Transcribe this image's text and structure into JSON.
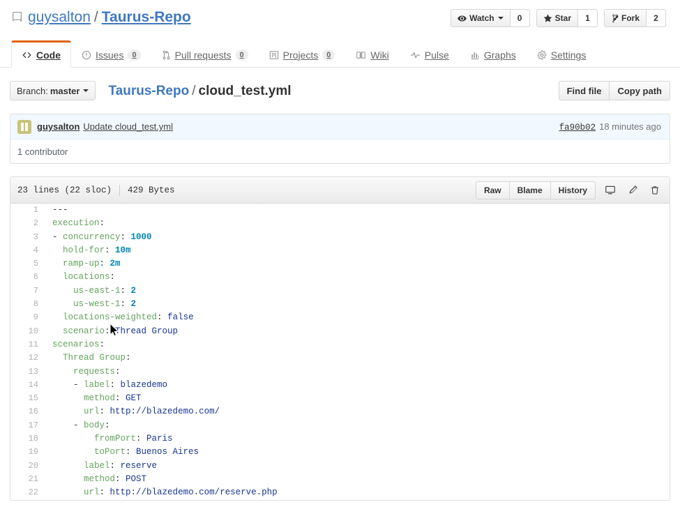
{
  "repo": {
    "icon": "repo-book-icon",
    "owner": "guysalton",
    "separator": "/",
    "name": "Taurus-Repo"
  },
  "actions": [
    {
      "icon": "eye-icon",
      "label": "Watch",
      "count": "0",
      "has_caret": true
    },
    {
      "icon": "star-icon",
      "label": "Star",
      "count": "1",
      "has_caret": false
    },
    {
      "icon": "fork-icon",
      "label": "Fork",
      "count": "2",
      "has_caret": false
    }
  ],
  "nav": {
    "tabs": [
      {
        "icon": "code-icon",
        "label": "Code",
        "counter": null,
        "selected": true
      },
      {
        "icon": "issue-opened-icon",
        "label": "Issues",
        "counter": "0",
        "selected": false
      },
      {
        "icon": "git-pull-request-icon",
        "label": "Pull requests",
        "counter": "0",
        "selected": false
      },
      {
        "icon": "project-icon",
        "label": "Projects",
        "counter": "0",
        "selected": false
      },
      {
        "icon": "book-icon",
        "label": "Wiki",
        "counter": null,
        "selected": false
      },
      {
        "icon": "pulse-icon",
        "label": "Pulse",
        "counter": null,
        "selected": false
      },
      {
        "icon": "graph-icon",
        "label": "Graphs",
        "counter": null,
        "selected": false
      },
      {
        "icon": "gear-icon",
        "label": "Settings",
        "counter": null,
        "selected": false
      }
    ]
  },
  "file_navigation": {
    "branch_prefix": "Branch:",
    "branch_name": "master",
    "breadcrumb_repo": "Taurus-Repo",
    "breadcrumb_separator": "/",
    "breadcrumb_file": "cloud_test.yml",
    "find_file_label": "Find file",
    "copy_path_label": "Copy path"
  },
  "commit": {
    "avatar": "user-avatar",
    "author": "guysalton",
    "message": "Update cloud_test.yml",
    "sha": "fa90b02",
    "time": "18 minutes ago",
    "contributors": "1 contributor"
  },
  "file": {
    "lines_info": "23 lines (22 sloc)",
    "size": "429 Bytes",
    "buttons": [
      "Raw",
      "Blame",
      "History"
    ],
    "icons": [
      "desktop-download-icon",
      "pencil-edit-icon",
      "trash-delete-icon"
    ],
    "lines": [
      {
        "num": "1",
        "tokens": [
          {
            "t": "---",
            "c": "p"
          }
        ]
      },
      {
        "num": "2",
        "tokens": [
          {
            "t": "execution",
            "c": "k"
          },
          {
            "t": ":",
            "c": "p"
          }
        ]
      },
      {
        "num": "3",
        "tokens": [
          {
            "t": "- ",
            "c": "p"
          },
          {
            "t": "concurrency",
            "c": "k"
          },
          {
            "t": ": ",
            "c": "p"
          },
          {
            "t": "1000",
            "c": "n"
          }
        ]
      },
      {
        "num": "4",
        "tokens": [
          {
            "t": "  ",
            "c": "p"
          },
          {
            "t": "hold-for",
            "c": "k"
          },
          {
            "t": ": ",
            "c": "p"
          },
          {
            "t": "10m",
            "c": "n"
          }
        ]
      },
      {
        "num": "5",
        "tokens": [
          {
            "t": "  ",
            "c": "p"
          },
          {
            "t": "ramp-up",
            "c": "k"
          },
          {
            "t": ": ",
            "c": "p"
          },
          {
            "t": "2m",
            "c": "n"
          }
        ]
      },
      {
        "num": "6",
        "tokens": [
          {
            "t": "  ",
            "c": "p"
          },
          {
            "t": "locations",
            "c": "k"
          },
          {
            "t": ":",
            "c": "p"
          }
        ]
      },
      {
        "num": "7",
        "tokens": [
          {
            "t": "    ",
            "c": "p"
          },
          {
            "t": "us-east-1",
            "c": "k"
          },
          {
            "t": ": ",
            "c": "p"
          },
          {
            "t": "2",
            "c": "n"
          }
        ]
      },
      {
        "num": "8",
        "tokens": [
          {
            "t": "    ",
            "c": "p"
          },
          {
            "t": "us-west-1",
            "c": "k"
          },
          {
            "t": ": ",
            "c": "p"
          },
          {
            "t": "2",
            "c": "n"
          }
        ]
      },
      {
        "num": "9",
        "tokens": [
          {
            "t": "  ",
            "c": "p"
          },
          {
            "t": "locations-weighted",
            "c": "k"
          },
          {
            "t": ": ",
            "c": "p"
          },
          {
            "t": "false",
            "c": "s"
          }
        ]
      },
      {
        "num": "10",
        "tokens": [
          {
            "t": "  ",
            "c": "p"
          },
          {
            "t": "scenario",
            "c": "k"
          },
          {
            "t": ": ",
            "c": "p"
          },
          {
            "t": "Thread Group",
            "c": "s"
          }
        ]
      },
      {
        "num": "11",
        "tokens": [
          {
            "t": "scenarios",
            "c": "k"
          },
          {
            "t": ":",
            "c": "p"
          }
        ]
      },
      {
        "num": "12",
        "tokens": [
          {
            "t": "  ",
            "c": "p"
          },
          {
            "t": "Thread Group",
            "c": "k"
          },
          {
            "t": ":",
            "c": "p"
          }
        ]
      },
      {
        "num": "13",
        "tokens": [
          {
            "t": "    ",
            "c": "p"
          },
          {
            "t": "requests",
            "c": "k"
          },
          {
            "t": ":",
            "c": "p"
          }
        ]
      },
      {
        "num": "14",
        "tokens": [
          {
            "t": "    - ",
            "c": "p"
          },
          {
            "t": "label",
            "c": "k"
          },
          {
            "t": ": ",
            "c": "p"
          },
          {
            "t": "blazedemo",
            "c": "s"
          }
        ]
      },
      {
        "num": "15",
        "tokens": [
          {
            "t": "      ",
            "c": "p"
          },
          {
            "t": "method",
            "c": "k"
          },
          {
            "t": ": ",
            "c": "p"
          },
          {
            "t": "GET",
            "c": "s"
          }
        ]
      },
      {
        "num": "16",
        "tokens": [
          {
            "t": "      ",
            "c": "p"
          },
          {
            "t": "url",
            "c": "k"
          },
          {
            "t": ": ",
            "c": "p"
          },
          {
            "t": "http://blazedemo.com/",
            "c": "s"
          }
        ]
      },
      {
        "num": "17",
        "tokens": [
          {
            "t": "    - ",
            "c": "p"
          },
          {
            "t": "body",
            "c": "k"
          },
          {
            "t": ":",
            "c": "p"
          }
        ]
      },
      {
        "num": "18",
        "tokens": [
          {
            "t": "        ",
            "c": "p"
          },
          {
            "t": "fromPort",
            "c": "k"
          },
          {
            "t": ": ",
            "c": "p"
          },
          {
            "t": "Paris",
            "c": "s"
          }
        ]
      },
      {
        "num": "19",
        "tokens": [
          {
            "t": "        ",
            "c": "p"
          },
          {
            "t": "toPort",
            "c": "k"
          },
          {
            "t": ": ",
            "c": "p"
          },
          {
            "t": "Buenos Aires",
            "c": "s"
          }
        ]
      },
      {
        "num": "20",
        "tokens": [
          {
            "t": "      ",
            "c": "p"
          },
          {
            "t": "label",
            "c": "k"
          },
          {
            "t": ": ",
            "c": "p"
          },
          {
            "t": "reserve",
            "c": "s"
          }
        ]
      },
      {
        "num": "21",
        "tokens": [
          {
            "t": "      ",
            "c": "p"
          },
          {
            "t": "method",
            "c": "k"
          },
          {
            "t": ": ",
            "c": "p"
          },
          {
            "t": "POST",
            "c": "s"
          }
        ]
      },
      {
        "num": "22",
        "tokens": [
          {
            "t": "      ",
            "c": "p"
          },
          {
            "t": "url",
            "c": "k"
          },
          {
            "t": ": ",
            "c": "p"
          },
          {
            "t": "http://blazedemo.com/reserve.php",
            "c": "s"
          }
        ]
      }
    ]
  },
  "colors": {
    "accent_blue": "#4078c0",
    "active_tab_orange": "#e36209",
    "yaml_key_green": "#63a35c",
    "yaml_number_blue": "#0086b3",
    "yaml_string_navy": "#183691",
    "commit_header_bg": "#f1f8ff"
  }
}
